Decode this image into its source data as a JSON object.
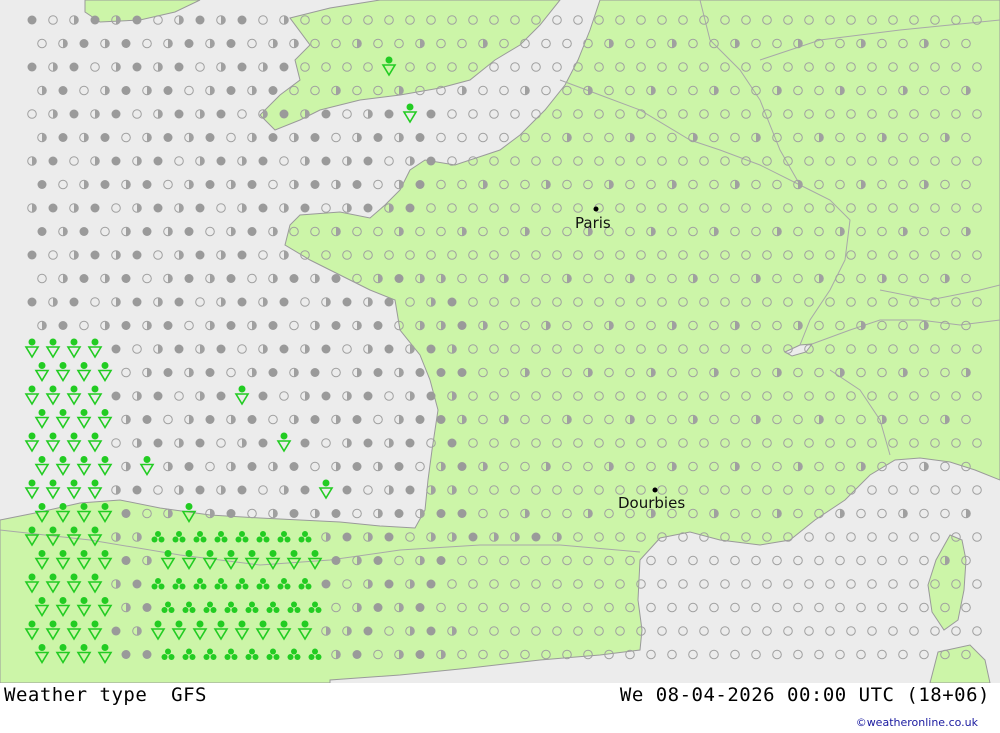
{
  "footer": {
    "title": "Weather type  GFS",
    "datetime": "We 08-04-2026 00:00 UTC (18+06)",
    "credit": "©weatheronline.co.uk"
  },
  "cities": [
    {
      "name": "Paris"
    },
    {
      "name": "Dourbies"
    }
  ],
  "colors": {
    "land": "#ccf5a8",
    "sea": "#ececec",
    "border": "#9a9a9a",
    "clear_marker": "#a0a0a0",
    "cloud_marker": "#9a9a9a",
    "precip_marker": "#22cc22"
  },
  "symbol_legend": {
    "clear": "open-circle-icon",
    "partly": "half-circle-icon",
    "cloudy": "filled-circle-icon",
    "rain": "rain-dots-icon",
    "shower": "shower-triangle-icon",
    "hail": "clover-icon"
  }
}
